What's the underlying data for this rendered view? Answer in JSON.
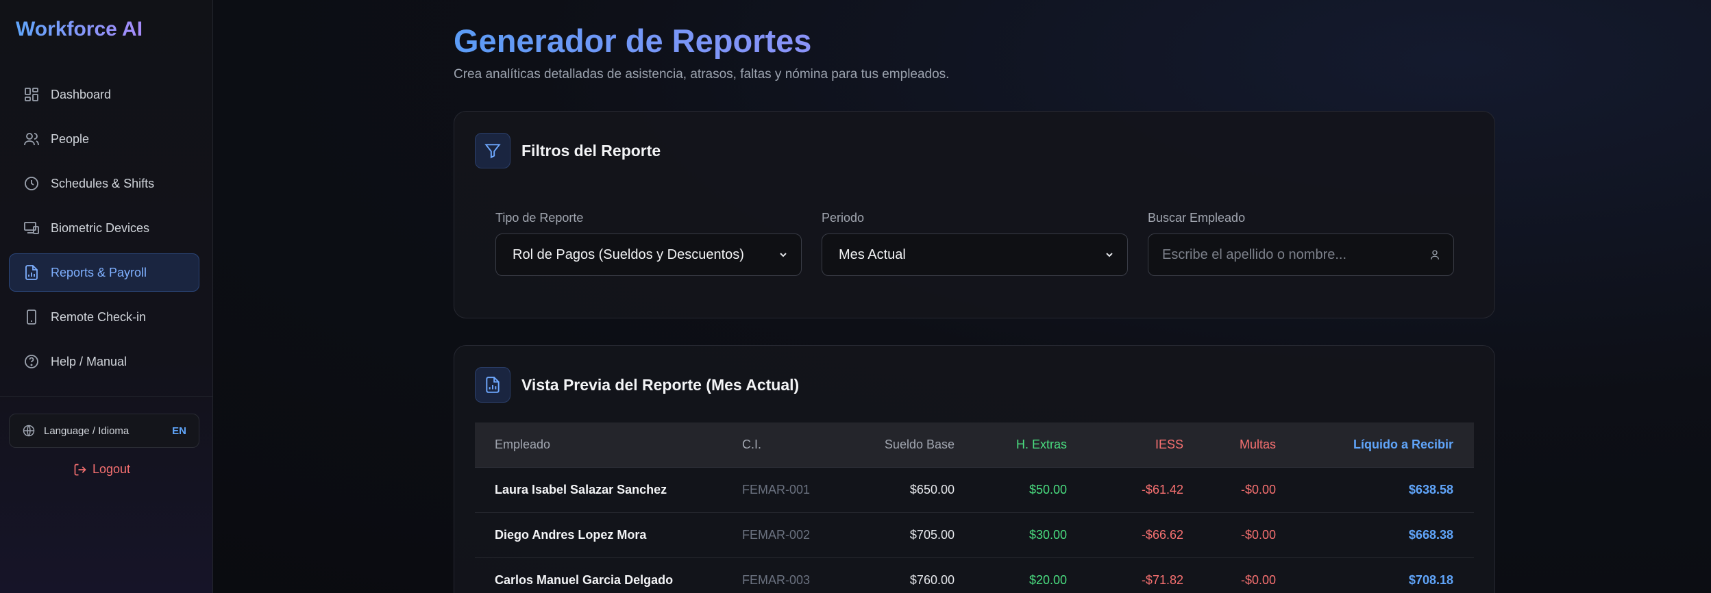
{
  "app": {
    "brand": "Workforce AI"
  },
  "sidebar": {
    "items": [
      {
        "label": "Dashboard",
        "icon": "dashboard-icon"
      },
      {
        "label": "People",
        "icon": "people-icon"
      },
      {
        "label": "Schedules & Shifts",
        "icon": "clock-icon"
      },
      {
        "label": "Biometric Devices",
        "icon": "devices-icon"
      },
      {
        "label": "Reports & Payroll",
        "icon": "report-icon",
        "active": true
      },
      {
        "label": "Remote Check-in",
        "icon": "phone-icon"
      },
      {
        "label": "Help / Manual",
        "icon": "help-icon"
      }
    ],
    "language": {
      "label": "Language / Idioma",
      "code": "EN"
    },
    "logout": "Logout"
  },
  "header": {
    "title": "Generador de Reportes",
    "subtitle": "Crea analíticas detalladas de asistencia, atrasos, faltas y nómina para tus empleados."
  },
  "filters": {
    "title": "Filtros del Reporte",
    "report_type": {
      "label": "Tipo de Reporte",
      "value": "Rol de Pagos (Sueldos y Descuentos)"
    },
    "period": {
      "label": "Periodo",
      "value": "Mes Actual"
    },
    "search": {
      "label": "Buscar Empleado",
      "placeholder": "Escribe el apellido o nombre..."
    }
  },
  "preview": {
    "title": "Vista Previa del Reporte (Mes Actual)",
    "columns": [
      "Empleado",
      "C.I.",
      "Sueldo Base",
      "H. Extras",
      "IESS",
      "Multas",
      "Líquido a Recibir"
    ],
    "rows": [
      {
        "name": "Laura Isabel Salazar Sanchez",
        "ci": "FEMAR-001",
        "base": "$650.00",
        "extras": "$50.00",
        "iess": "-$61.42",
        "multas": "-$0.00",
        "liquido": "$638.58"
      },
      {
        "name": "Diego Andres Lopez Mora",
        "ci": "FEMAR-002",
        "base": "$705.00",
        "extras": "$30.00",
        "iess": "-$66.62",
        "multas": "-$0.00",
        "liquido": "$668.38"
      },
      {
        "name": "Carlos Manuel Garcia Delgado",
        "ci": "FEMAR-003",
        "base": "$760.00",
        "extras": "$20.00",
        "iess": "-$71.82",
        "multas": "-$0.00",
        "liquido": "$708.18"
      }
    ]
  },
  "colors": {
    "accent": "#60a5fa",
    "positive": "#4ade80",
    "negative": "#f87171"
  }
}
